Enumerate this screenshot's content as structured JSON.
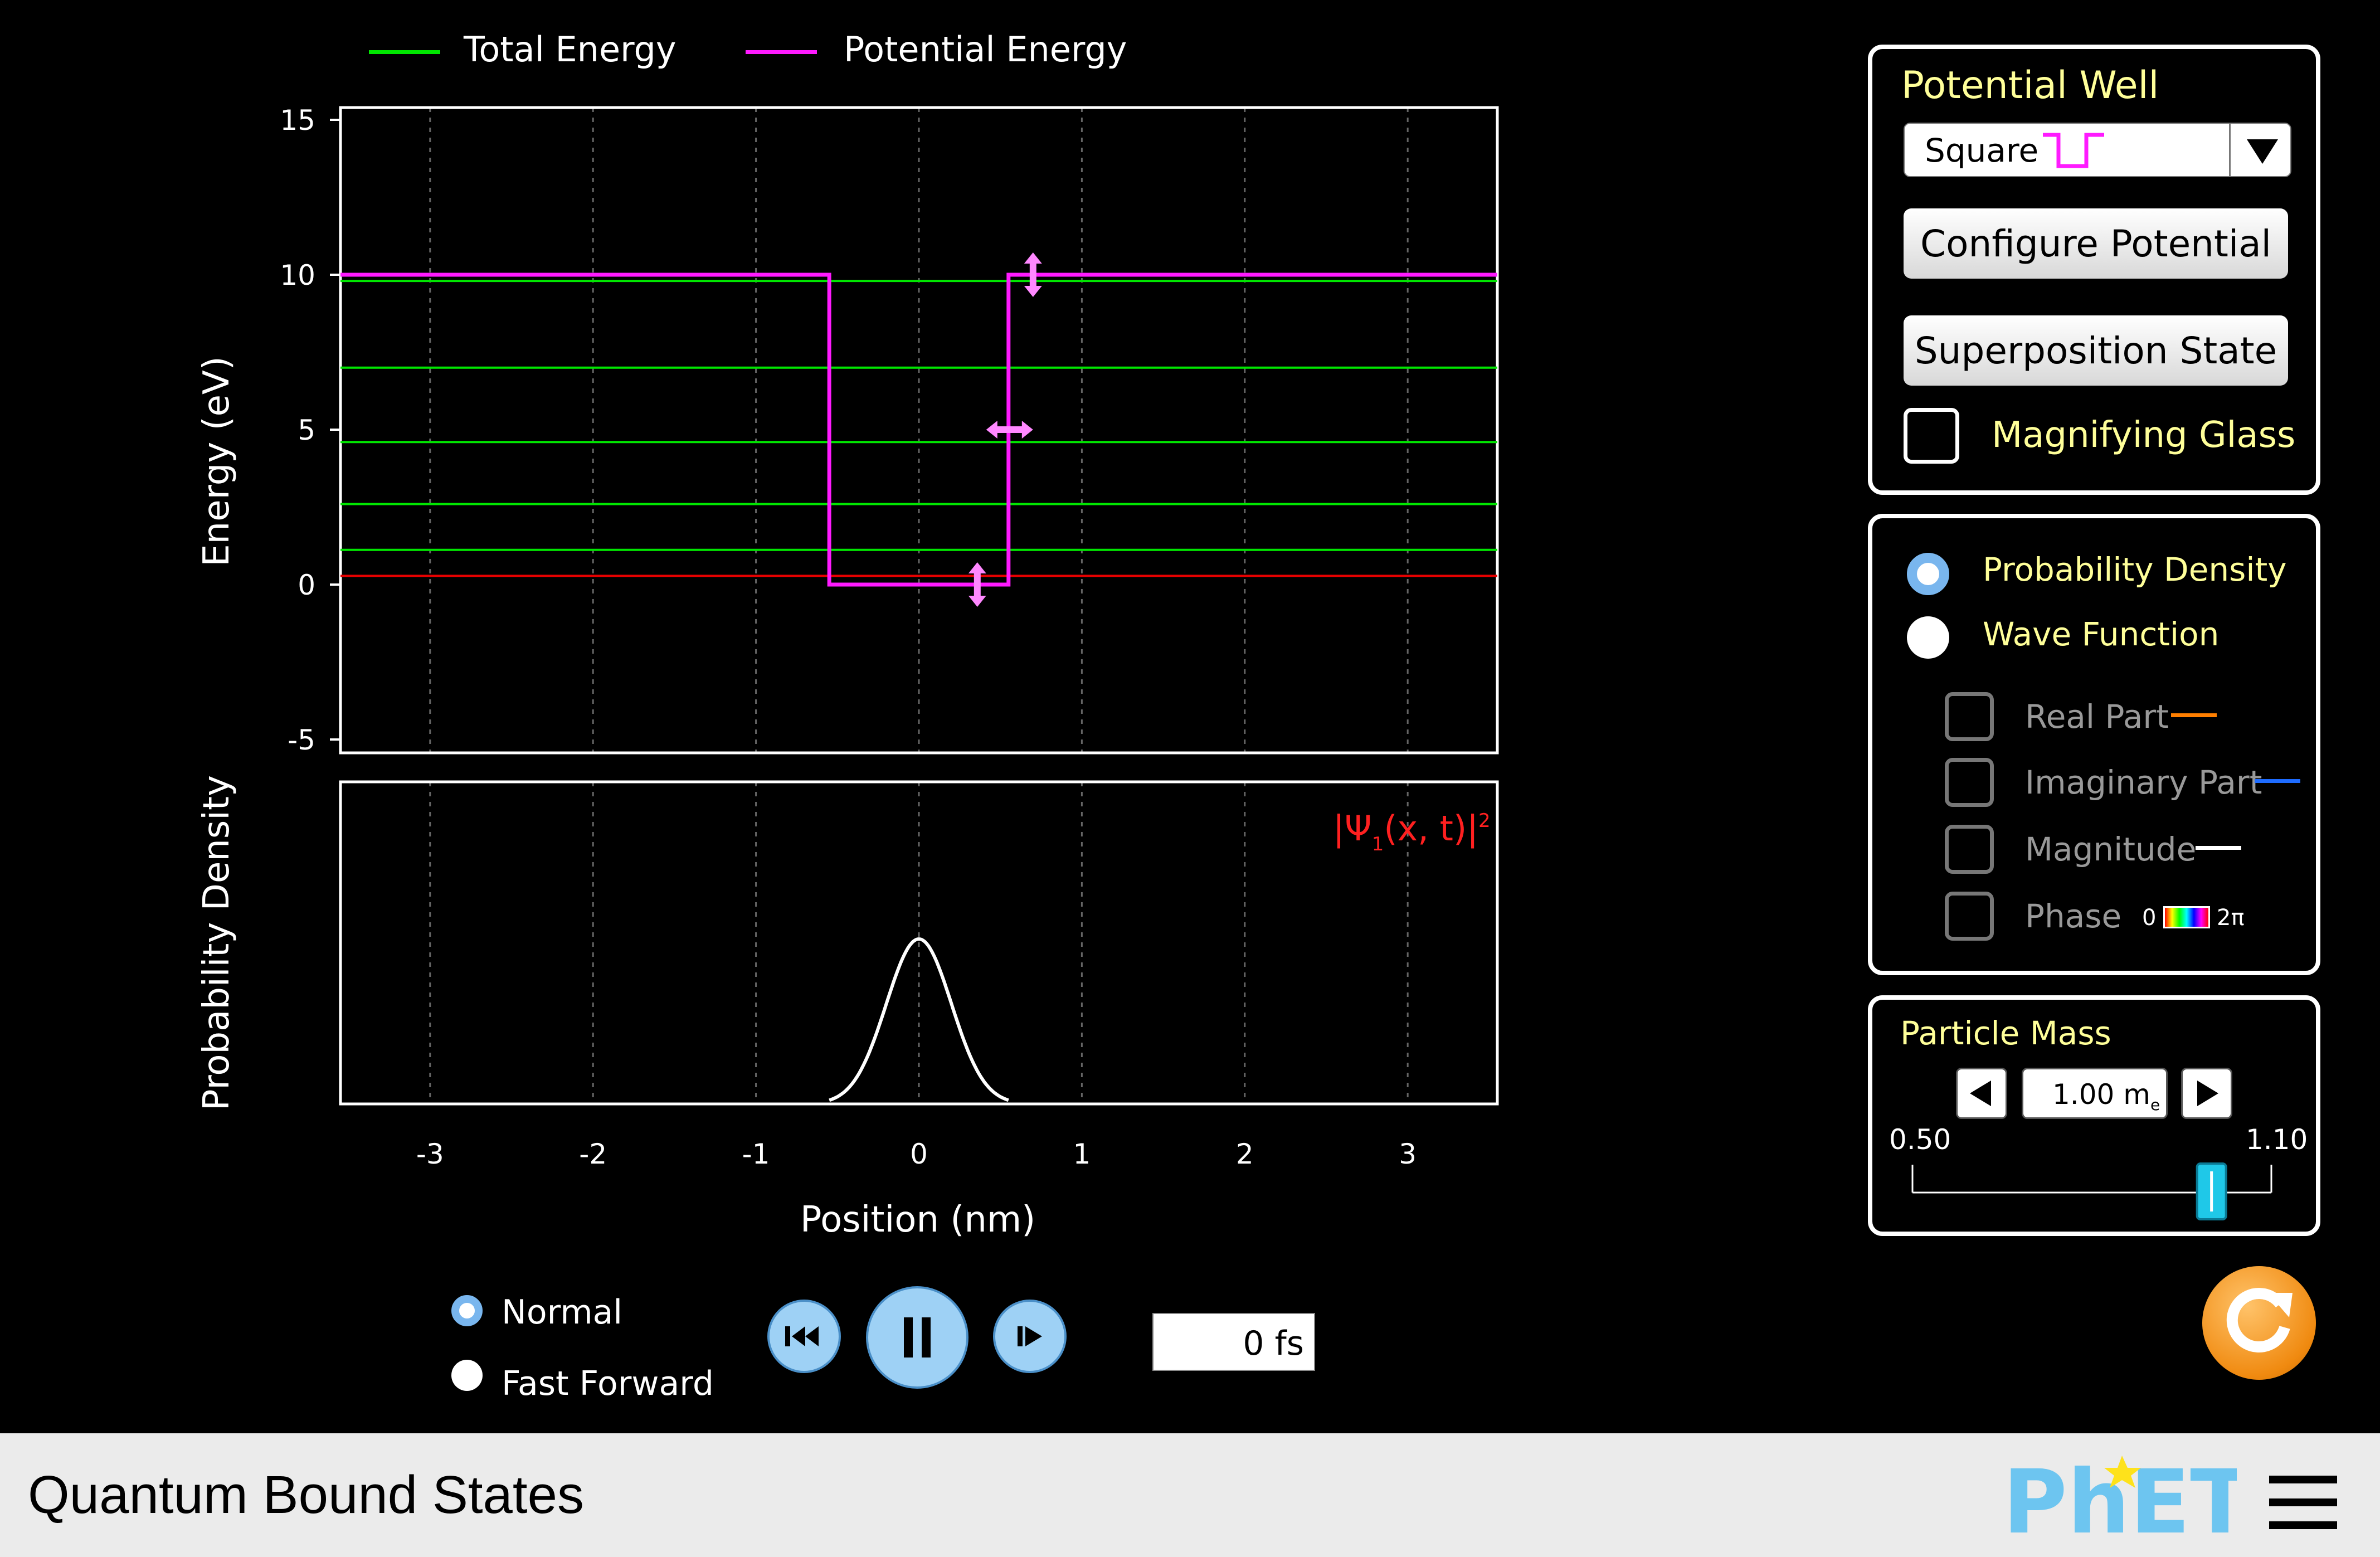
{
  "legend": {
    "total_energy": "Total Energy",
    "potential_energy": "Potential Energy"
  },
  "energy_plot": {
    "ylabel": "Energy (eV)",
    "yticks": [
      "15",
      "10",
      "5",
      "0",
      "-5"
    ],
    "total_energy_levels_eV": [
      0.28,
      1.12,
      2.6,
      4.6,
      7.0,
      9.8
    ],
    "selected_level_eV": 0.28,
    "potential": {
      "type": "square",
      "outside_eV": 10,
      "inside_eV": 0,
      "left_nm": -0.55,
      "right_nm": 0.55
    }
  },
  "density_plot": {
    "ylabel": "Probability Density",
    "formula": {
      "prefix": "|Ψ",
      "subscript": "1",
      "middle": "(x, t)|",
      "superscript": "2"
    },
    "gaussian_center_nm": 0,
    "gaussian_sigma_nm": 0.2
  },
  "x_axis": {
    "label": "Position (nm)",
    "ticks": [
      "-3",
      "-2",
      "-1",
      "0",
      "1",
      "2",
      "3"
    ],
    "range_nm": [
      -3.55,
      3.55
    ]
  },
  "speed": {
    "normal": "Normal",
    "fast_forward": "Fast Forward",
    "selected": "normal"
  },
  "time_display": "0 fs",
  "potential_well_panel": {
    "title": "Potential Well",
    "selected_well": "Square",
    "configure_button": "Configure Potential",
    "superposition_button": "Superposition State",
    "magnifying_glass": "Magnifying Glass"
  },
  "view_panel": {
    "probability_density": "Probability Density",
    "wave_function": "Wave Function",
    "selected": "probability_density",
    "real_part": "Real Part",
    "imaginary_part": "Imaginary Part",
    "magnitude": "Magnitude",
    "phase": "Phase",
    "phase_min": "0",
    "phase_max": "2π",
    "colors": {
      "real": "#ff7f00",
      "imaginary": "#1e6cff",
      "magnitude": "#ffffff"
    }
  },
  "particle_mass": {
    "title": "Particle Mass",
    "value": "1.00 m",
    "unit_sub": "e",
    "min_label": "0.50",
    "max_label": "1.10",
    "min": 0.5,
    "max": 1.1,
    "current": 1.0
  },
  "footer": {
    "title": "Quantum Bound States",
    "brand": "PhET"
  },
  "colors": {
    "total_energy": "#00e600",
    "selected_level": "#e60000",
    "potential": "#ff1aff",
    "text_yellow": "#ffff99",
    "handle": "#ff88ff"
  }
}
